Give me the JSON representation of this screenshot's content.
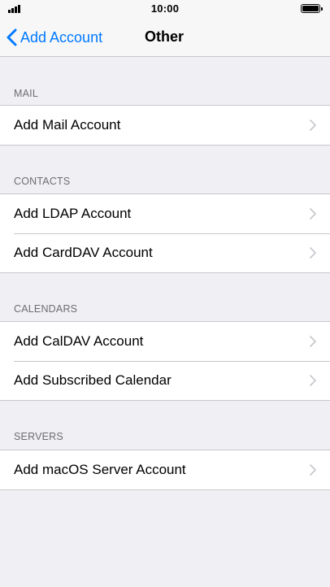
{
  "status_bar": {
    "time": "10:00",
    "signal_icon": "cellular-signal-icon",
    "battery_icon": "battery-full-icon"
  },
  "nav": {
    "back_label": "Add Account",
    "back_icon": "chevron-left-icon",
    "title": "Other",
    "accent_color": "#007aff"
  },
  "sections": {
    "mail": {
      "header": "MAIL",
      "items": [
        {
          "label": "Add Mail Account"
        }
      ]
    },
    "contacts": {
      "header": "CONTACTS",
      "items": [
        {
          "label": "Add LDAP Account"
        },
        {
          "label": "Add CardDAV Account"
        }
      ]
    },
    "calendars": {
      "header": "CALENDARS",
      "items": [
        {
          "label": "Add CalDAV Account"
        },
        {
          "label": "Add Subscribed Calendar"
        }
      ]
    },
    "servers": {
      "header": "SERVERS",
      "items": [
        {
          "label": "Add macOS Server Account"
        }
      ]
    }
  },
  "colors": {
    "background": "#efeff4",
    "separator": "#c8c7cc",
    "section_header": "#6d6d72",
    "disclosure": "#c7c7cc"
  }
}
